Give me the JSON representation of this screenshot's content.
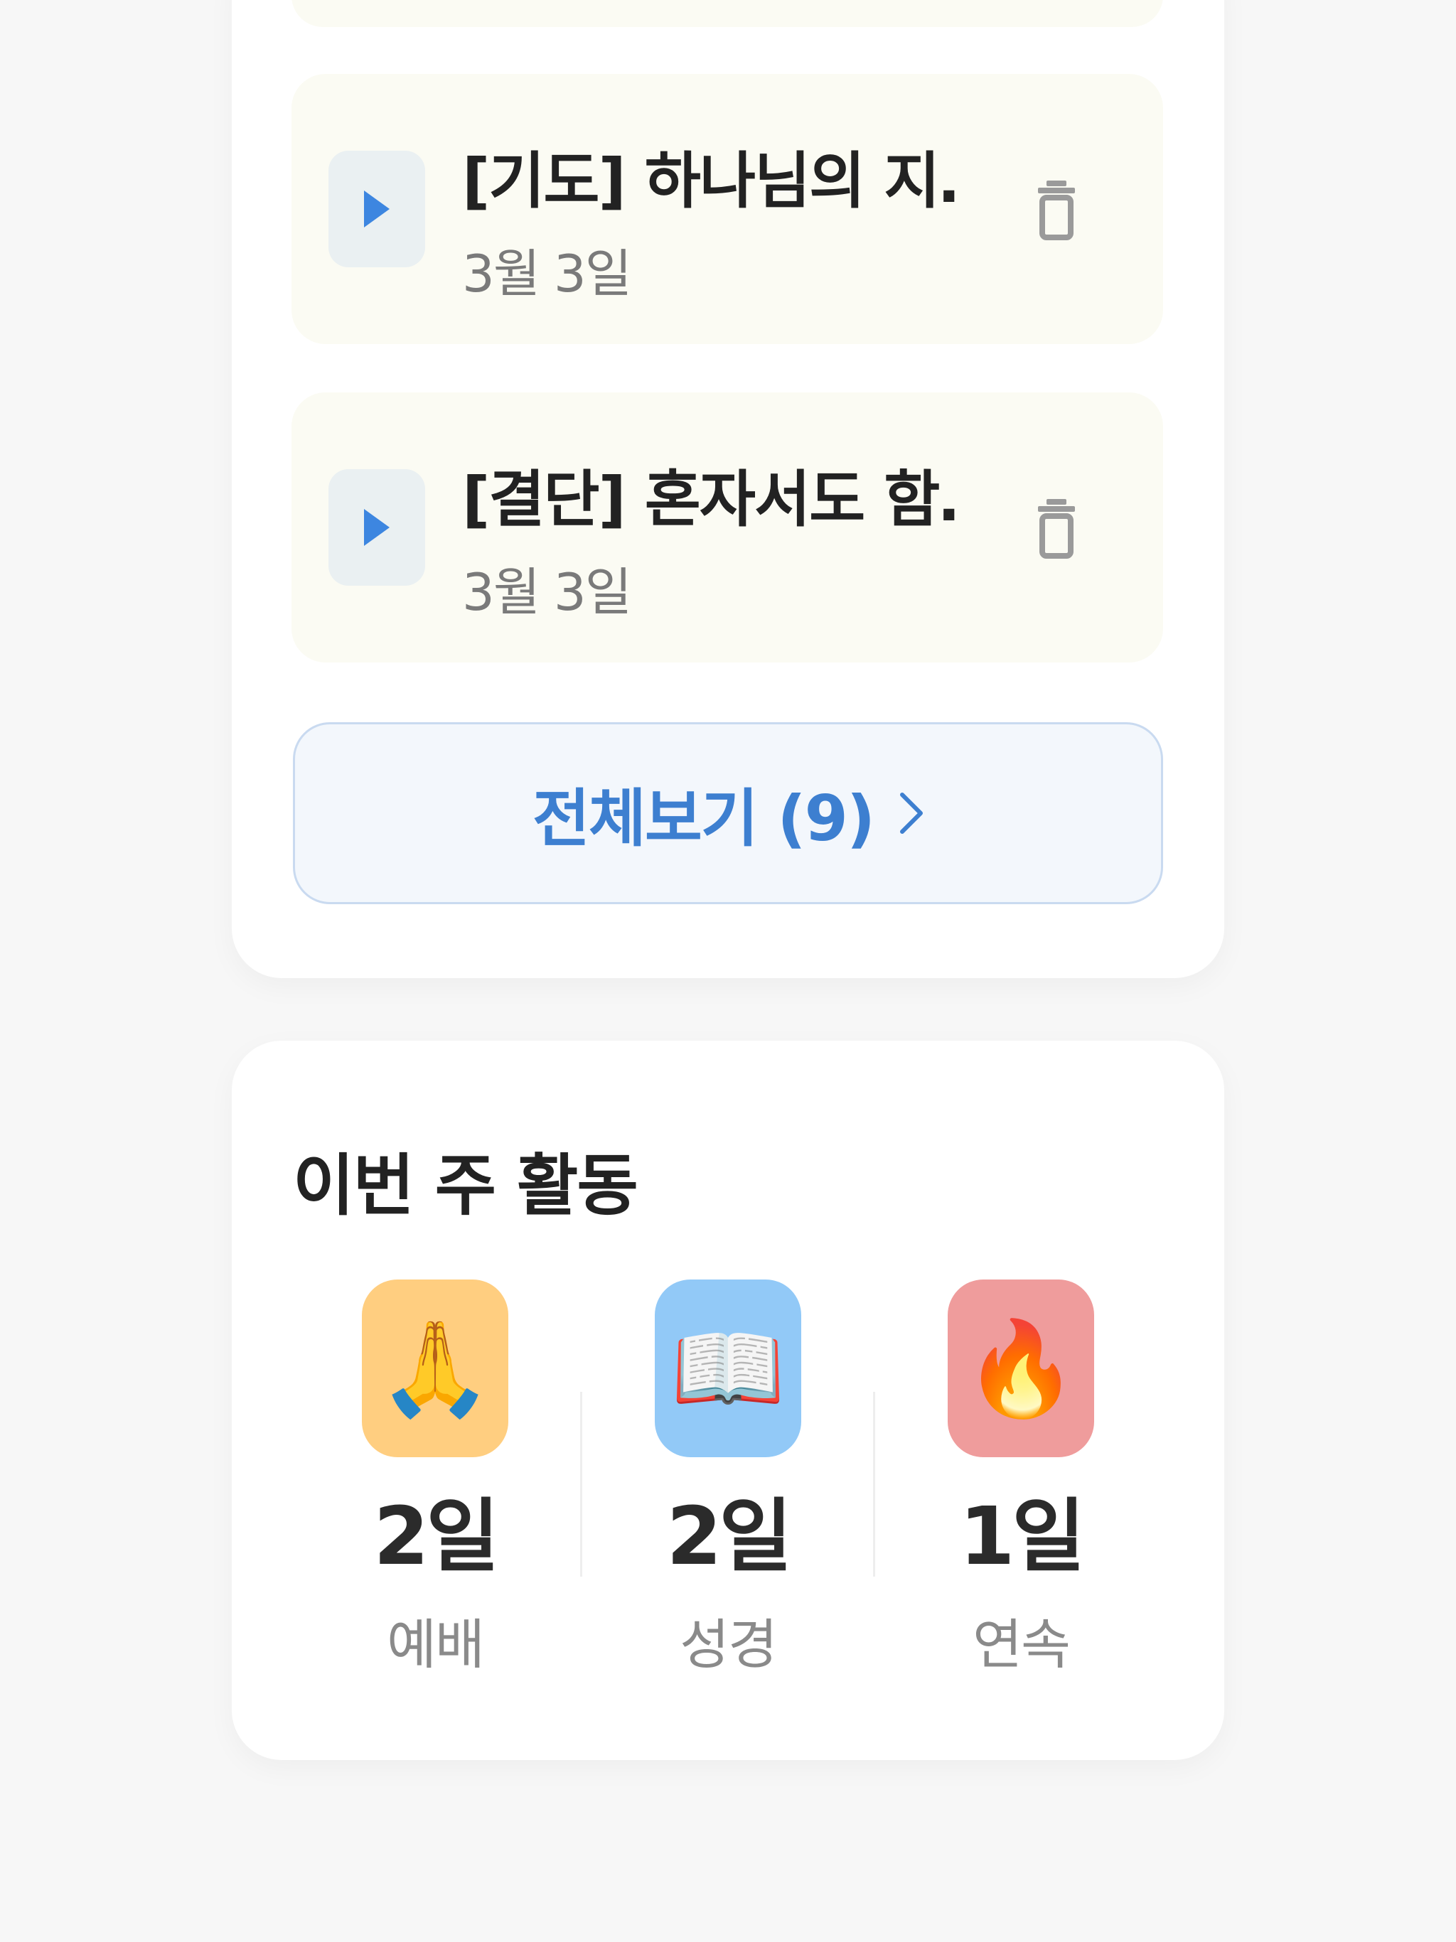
{
  "recordings": {
    "items": [
      {
        "title": "[기도] 하나님의 지…",
        "date": "3월 3일"
      },
      {
        "title": "[결단] 혼자서도 함…",
        "date": "3월 3일"
      }
    ],
    "view_all_label": "전체보기 (9)"
  },
  "weekly_activity": {
    "title": "이번 주 활동",
    "stats": [
      {
        "emoji": "🙏",
        "value": "2일",
        "label": "예배",
        "color": "#ffce80"
      },
      {
        "emoji": "📖",
        "value": "2일",
        "label": "성경",
        "color": "#92c9f7"
      },
      {
        "emoji": "🔥",
        "value": "1일",
        "label": "연속",
        "color": "#ef9c9c"
      }
    ]
  },
  "colors": {
    "accent": "#3d7fd0",
    "item_background": "#fbfbf3",
    "page_background": "#f7f7f7"
  },
  "icons": [
    "play-icon",
    "trash-icon",
    "chevron-right-icon"
  ]
}
